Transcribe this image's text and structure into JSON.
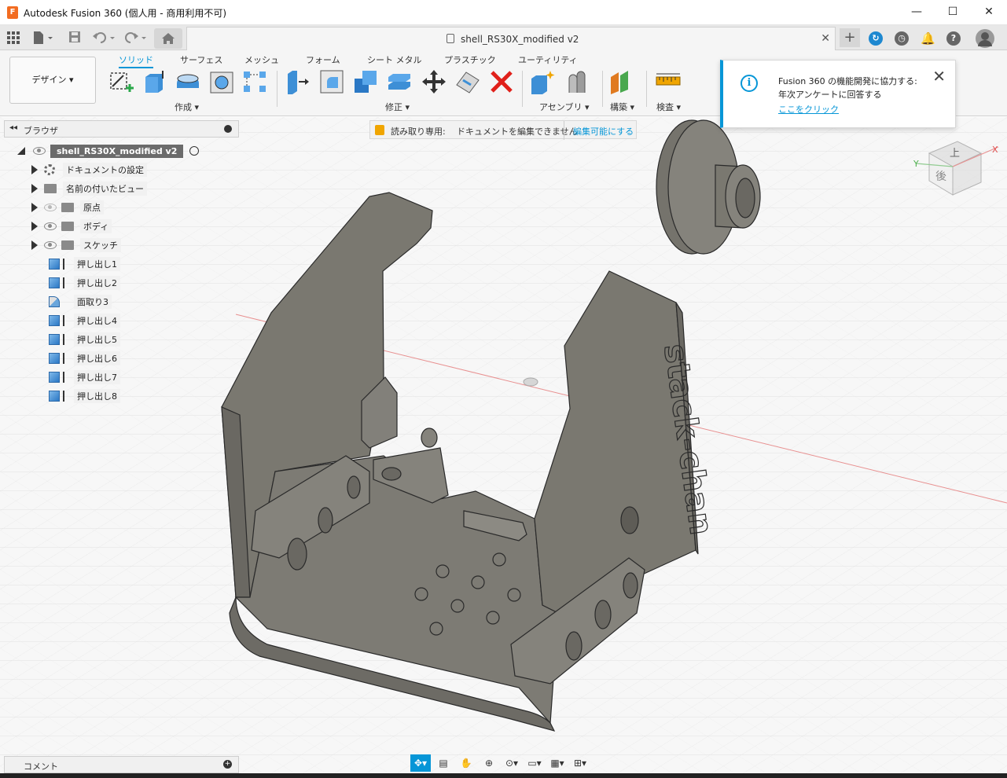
{
  "titlebar": {
    "title": "Autodesk Fusion 360 (個人用 - 商用利用不可)",
    "minimize": "—",
    "maximize": "☐",
    "close": "✕"
  },
  "tabs": {
    "document_name": "shell_RS30X_modified v2",
    "close": "✕",
    "new_tab": "+"
  },
  "ribbon": {
    "workspace": "デザイン ▾",
    "tabs": [
      "ソリッド",
      "サーフェス",
      "メッシュ",
      "フォーム",
      "シート メタル",
      "プラスチック",
      "ユーティリティ"
    ],
    "groups": [
      "作成 ▾",
      "修正 ▾",
      "アセンブリ ▾",
      "構築 ▾",
      "検査 ▾"
    ]
  },
  "browser": {
    "title": "ブラウザ",
    "root": "shell_RS30X_modified v2",
    "items": [
      {
        "label": "ドキュメントの設定"
      },
      {
        "label": "名前の付いたビュー"
      },
      {
        "label": "原点"
      },
      {
        "label": "ボディ"
      },
      {
        "label": "スケッチ"
      },
      {
        "label": "押し出し1"
      },
      {
        "label": "押し出し2"
      },
      {
        "label": "面取り3"
      },
      {
        "label": "押し出し4"
      },
      {
        "label": "押し出し5"
      },
      {
        "label": "押し出し6"
      },
      {
        "label": "押し出し7"
      },
      {
        "label": "押し出し8"
      }
    ]
  },
  "readonly": {
    "label": "読み取り専用:",
    "message": "ドキュメントを編集できません",
    "action": "編集可能にする"
  },
  "notification": {
    "message": "Fusion 360 の機能開発に協力する: 年次アンケートに回答する",
    "link": "ここをクリック"
  },
  "model": {
    "text": "stack-chan"
  },
  "viewcube": {
    "face_top": "上",
    "face_back": "後",
    "axis_x": "X",
    "axis_y": "Y"
  },
  "comments": {
    "title": "コメント"
  },
  "colors": {
    "accent": "#0696d7",
    "model": "#7a7870",
    "lock": "#f0a500"
  }
}
